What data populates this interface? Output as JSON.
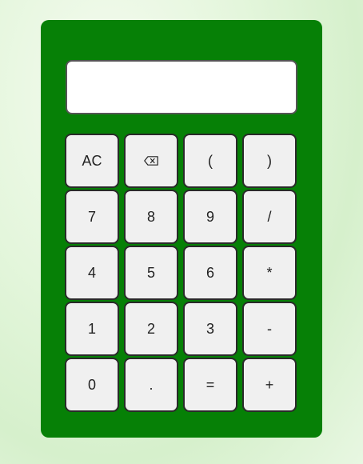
{
  "display": {
    "value": ""
  },
  "keys": [
    {
      "label": "AC",
      "name": "clear-button"
    },
    {
      "label": "",
      "icon": "backspace-icon",
      "name": "backspace-button"
    },
    {
      "label": "(",
      "name": "open-paren-button"
    },
    {
      "label": ")",
      "name": "close-paren-button"
    },
    {
      "label": "7",
      "name": "digit-7-button"
    },
    {
      "label": "8",
      "name": "digit-8-button"
    },
    {
      "label": "9",
      "name": "digit-9-button"
    },
    {
      "label": "/",
      "name": "divide-button"
    },
    {
      "label": "4",
      "name": "digit-4-button"
    },
    {
      "label": "5",
      "name": "digit-5-button"
    },
    {
      "label": "6",
      "name": "digit-6-button"
    },
    {
      "label": "*",
      "name": "multiply-button"
    },
    {
      "label": "1",
      "name": "digit-1-button"
    },
    {
      "label": "2",
      "name": "digit-2-button"
    },
    {
      "label": "3",
      "name": "digit-3-button"
    },
    {
      "label": "-",
      "name": "subtract-button"
    },
    {
      "label": "0",
      "name": "digit-0-button"
    },
    {
      "label": ".",
      "name": "decimal-button"
    },
    {
      "label": "=",
      "name": "equals-button"
    },
    {
      "label": "+",
      "name": "add-button"
    }
  ],
  "colors": {
    "calculator_body": "#068006",
    "key_background": "#f0f0f0",
    "display_background": "#ffffff"
  }
}
